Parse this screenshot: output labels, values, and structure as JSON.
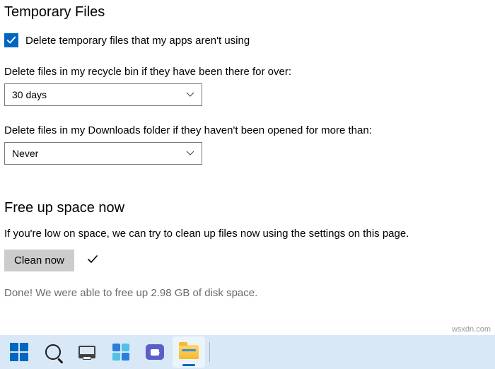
{
  "tempFiles": {
    "heading": "Temporary Files",
    "checkboxLabel": "Delete temporary files that my apps aren't using",
    "checkboxChecked": true,
    "recycleLabel": "Delete files in my recycle bin if they have been there for over:",
    "recycleValue": "30 days",
    "downloadsLabel": "Delete files in my Downloads folder if they haven't been opened for more than:",
    "downloadsValue": "Never"
  },
  "freeUp": {
    "heading": "Free up space now",
    "description": "If you're low on space, we can try to clean up files now using the settings on this page.",
    "buttonLabel": "Clean now",
    "statusText": "Done! We were able to free up 2.98 GB of disk space."
  },
  "watermark": "wsxdn.com",
  "colors": {
    "accent": "#0067c0",
    "taskbarBg": "#d9e8f7"
  }
}
